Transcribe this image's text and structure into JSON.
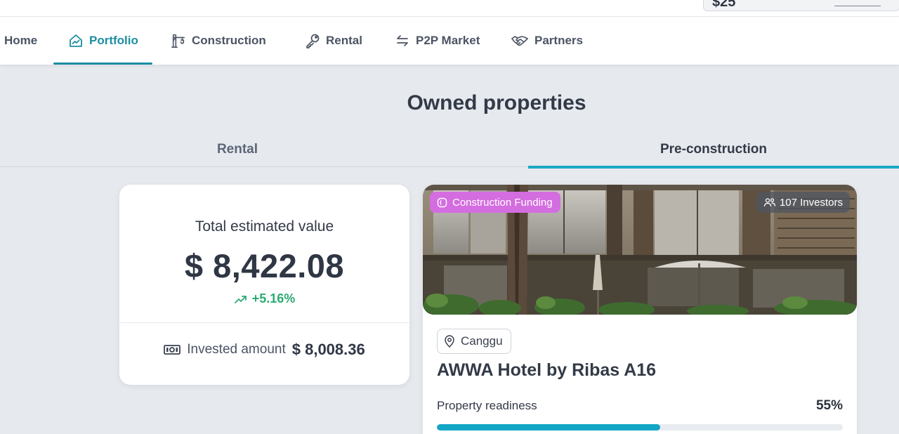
{
  "account": {
    "balance_text": "$25"
  },
  "nav": {
    "items": [
      {
        "label": "Home",
        "icon": "none"
      },
      {
        "label": "Portfolio",
        "icon": "chart-house-icon",
        "active": true
      },
      {
        "label": "Construction",
        "icon": "crane-icon"
      },
      {
        "label": "Rental",
        "icon": "key-icon"
      },
      {
        "label": "P2P Market",
        "icon": "swap-arrows-icon"
      },
      {
        "label": "Partners",
        "icon": "handshake-icon"
      }
    ],
    "accent_color": "#1c8ea1"
  },
  "page": {
    "title": "Owned properties",
    "tabs": [
      {
        "label": "Rental",
        "active": false
      },
      {
        "label": "Pre-construction",
        "active": true
      }
    ]
  },
  "summary": {
    "label": "Total estimated value",
    "total": "$ 8,422.08",
    "change": "+5.16%",
    "change_color": "#2cab72",
    "invested_label": "Invested amount",
    "invested_amount": "$ 8,008.36"
  },
  "property": {
    "badge_funding": "Construction Funding",
    "badge_funding_color": "#d46de0",
    "investors": "107 Investors",
    "location": "Canggu",
    "title": "AWWA Hotel by Ribas A16",
    "readiness_label": "Property readiness",
    "readiness_text": "55%",
    "readiness_value": 0.55,
    "progress_color": "#13a6c4"
  }
}
